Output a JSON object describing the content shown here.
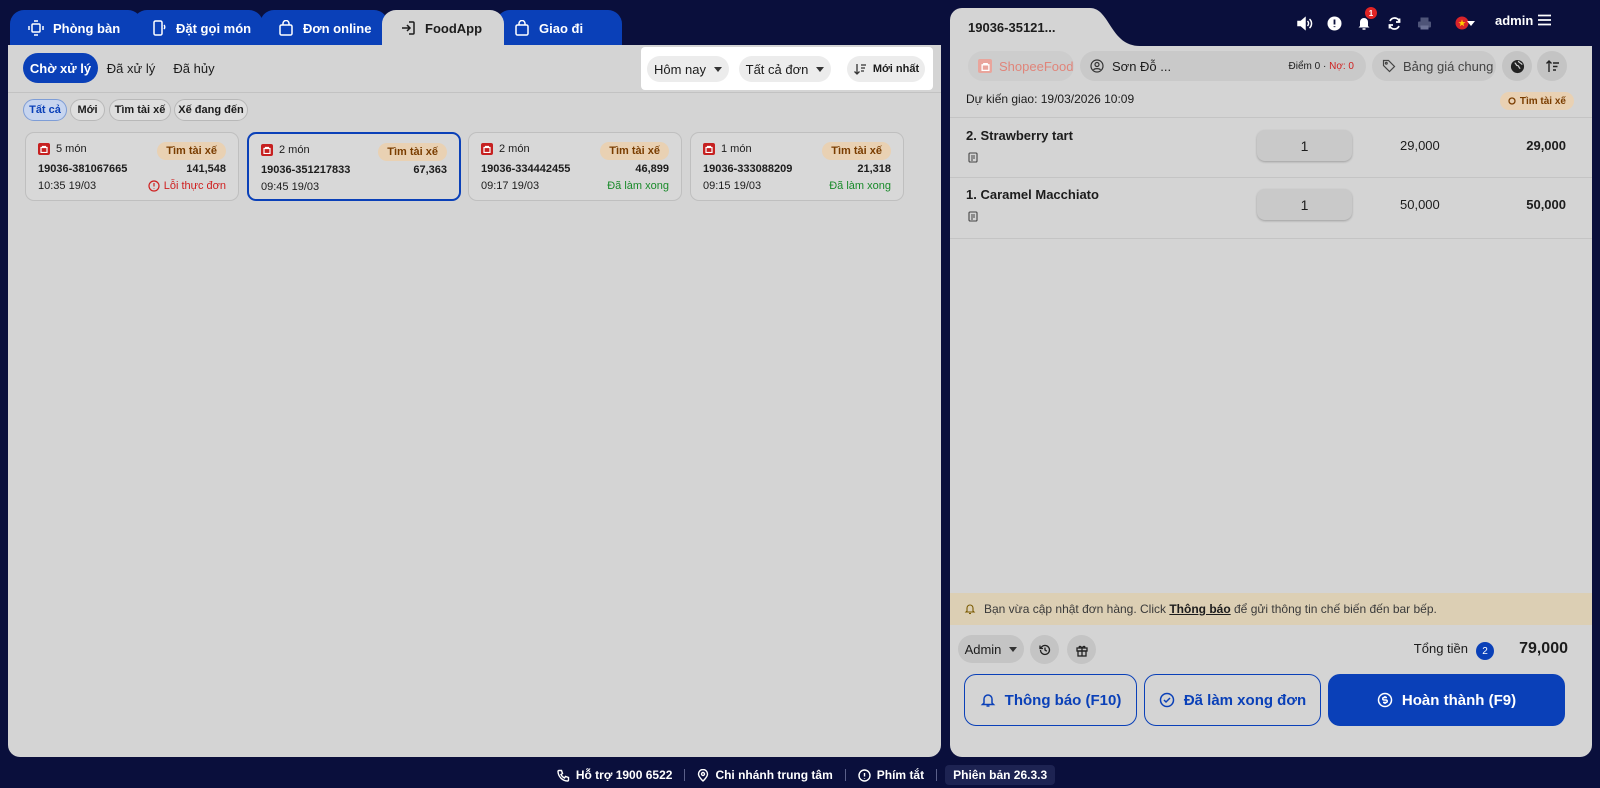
{
  "tabs": [
    {
      "label": "Phòng bàn",
      "icon": "dining-table-icon"
    },
    {
      "label": "Đặt gọi món",
      "icon": "mobile-order-icon"
    },
    {
      "label": "Đơn online",
      "icon": "shopping-bag-icon"
    },
    {
      "label": "FoodApp",
      "icon": "login-arrow-icon",
      "active": true
    },
    {
      "label": "Giao đi",
      "icon": "shopping-bag-icon"
    }
  ],
  "status_tabs": [
    "Chờ xử lý",
    "Đã xử lý",
    "Đã hủy"
  ],
  "filters": {
    "date": "Hôm nay",
    "orders": "Tất cả đơn",
    "sort": "Mới nhất"
  },
  "chips": [
    "Tất cả",
    "Mới",
    "Tìm tài xế",
    "Xế đang đến"
  ],
  "orders": [
    {
      "count": "5 món",
      "badge": "Tìm tài xế",
      "code": "19036-381067665",
      "amount": "141,548",
      "time": "10:35 19/03",
      "status": "Lỗi thực đơn",
      "status_type": "error"
    },
    {
      "count": "2 món",
      "badge": "Tìm tài xế",
      "code": "19036-351217833",
      "amount": "67,363",
      "time": "09:45 19/03",
      "status": "",
      "status_type": "none",
      "selected": true
    },
    {
      "count": "2 món",
      "badge": "Tìm tài xế",
      "code": "19036-334442455",
      "amount": "46,899",
      "time": "09:17 19/03",
      "status": "Đã làm xong",
      "status_type": "done"
    },
    {
      "count": "1 món",
      "badge": "Tìm tài xế",
      "code": "19036-333088209",
      "amount": "21,318",
      "time": "09:15 19/03",
      "status": "Đã làm xong",
      "status_type": "done"
    }
  ],
  "detail": {
    "tab_title": "19036-35121...",
    "source": "ShopeeFood",
    "customer": "Sơn Đỗ ...",
    "points_label": "Điểm 0",
    "debt_label": "Nợ: 0",
    "price_list": "Bảng giá chung",
    "eta": "Dự kiến giao: 19/03/2026 10:09",
    "eta_badge": "Tìm tài xế",
    "items": [
      {
        "name": "2. Strawberry tart",
        "qty": "1",
        "price": "29,000",
        "total": "29,000"
      },
      {
        "name": "1. Caramel Macchiato",
        "qty": "1",
        "price": "50,000",
        "total": "50,000"
      }
    ],
    "notice_prefix": "Bạn vừa cập nhật đơn hàng. Click ",
    "notice_link": "Thông báo",
    "notice_suffix": " để gửi thông tin chế biến đến bar bếp.",
    "staff": "Admin",
    "total_label": "Tổng tiền",
    "total_count": "2",
    "total_value": "79,000",
    "btn_notify": "Thông báo (F10)",
    "btn_done": "Đã làm xong đơn",
    "btn_complete": "Hoàn thành (F9)"
  },
  "topbar": {
    "notif_count": "1",
    "user": "admin"
  },
  "footer": {
    "support": "Hỗ trợ 1900 6522",
    "branch": "Chi nhánh trung tâm",
    "shortcuts": "Phím tắt",
    "version": "Phiên bản 26.3.3"
  },
  "colors": {
    "primary": "#0a40b8",
    "background": "#0a0f3c",
    "panel": "#d4d4d4",
    "error": "#cf1f1f",
    "success": "#198a2a"
  }
}
